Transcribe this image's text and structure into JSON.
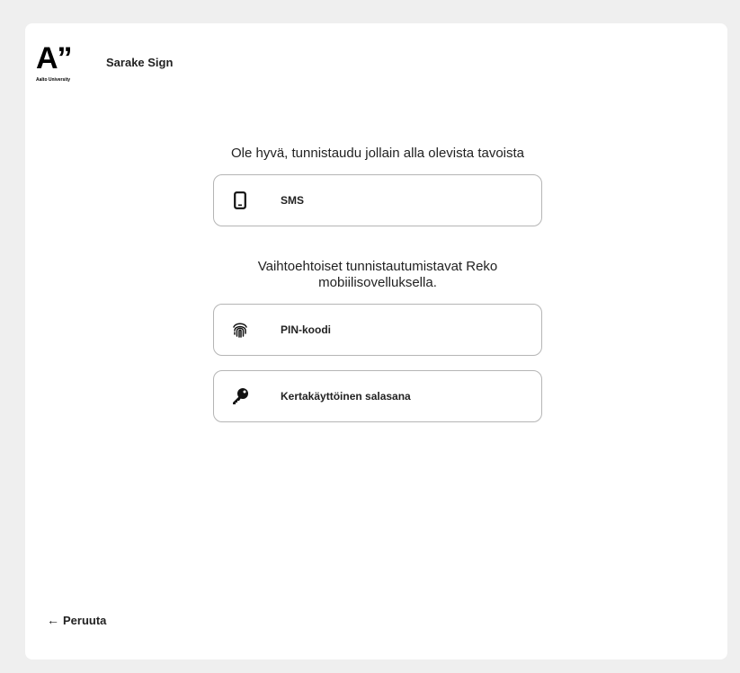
{
  "brand": {
    "logo_mark": "A”",
    "logo_sub": "Aalto University",
    "app_title": "Sarake Sign"
  },
  "main": {
    "prompt": "Ole hyvä, tunnistaudu jollain alla olevista tavoista",
    "sms": {
      "label": "SMS",
      "icon": "mobile-phone-icon"
    },
    "alt_prompt": "Vaihtoehtoiset tunnistautumistavat Reko mobiilisovelluksella.",
    "pin": {
      "label": "PIN-koodi",
      "icon": "fingerprint-icon"
    },
    "otp": {
      "label": "Kertakäyttöinen salasana",
      "icon": "key-icon"
    }
  },
  "footer": {
    "cancel_arrow": "←",
    "cancel_label": "Peruuta"
  }
}
